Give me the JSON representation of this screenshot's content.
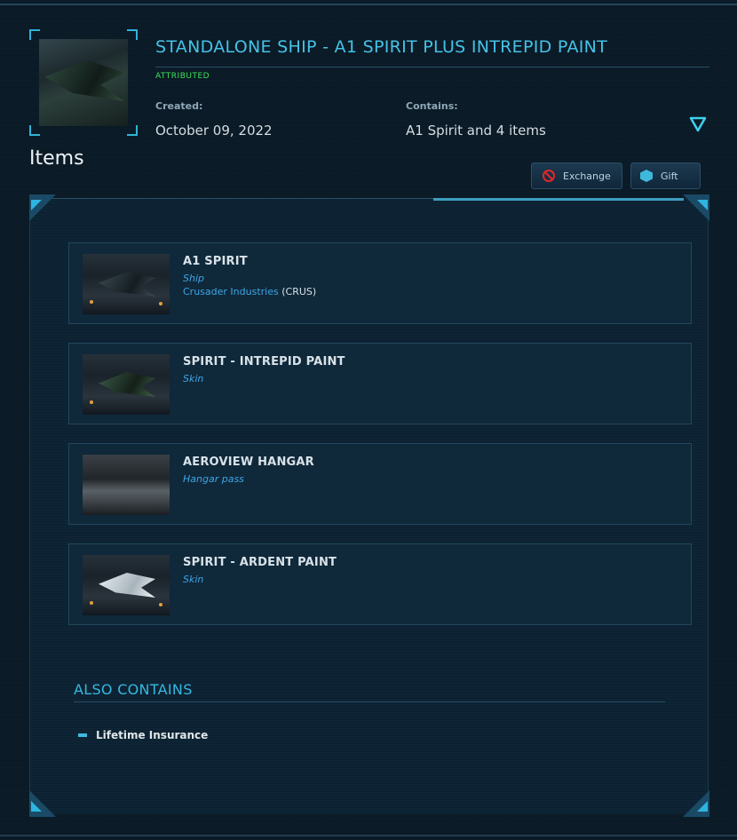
{
  "header": {
    "title": "STANDALONE SHIP - A1 SPIRIT PLUS INTREPID PAINT",
    "badge": "ATTRIBUTED",
    "created_label": "Created:",
    "created_value": "October 09, 2022",
    "contains_label": "Contains:",
    "contains_value": "A1 Spirit and 4 items",
    "collapse_icon": "triangle-down-icon"
  },
  "items_heading": "Items",
  "actions": {
    "exchange_label": "Exchange",
    "exchange_icon": "no-entry-icon",
    "gift_label": "Gift",
    "gift_icon": "cube-icon"
  },
  "items": [
    {
      "name": "A1 SPIRIT",
      "type": "Ship",
      "manufacturer": "Crusader Industries",
      "manufacturer_code": "(CRUS)"
    },
    {
      "name": "SPIRIT - INTREPID PAINT",
      "type": "Skin"
    },
    {
      "name": "AEROVIEW HANGAR",
      "type": "Hangar pass"
    },
    {
      "name": "SPIRIT - ARDENT PAINT",
      "type": "Skin"
    }
  ],
  "also_contains": {
    "heading": "ALSO CONTAINS",
    "items": [
      "Lifetime Insurance"
    ]
  },
  "colors": {
    "accent": "#45c2e8",
    "badge": "#3be35a",
    "link": "#3ea6e6",
    "danger": "#e02828"
  }
}
